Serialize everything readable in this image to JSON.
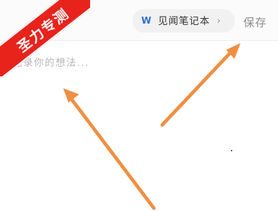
{
  "header": {
    "notebook": {
      "icon": "wps-w-icon",
      "icon_text": "W",
      "name": "见闻笔记本",
      "chevron": "›"
    },
    "save_label": "保存"
  },
  "editor": {
    "placeholder": "记录你的想法..."
  },
  "watermark": {
    "text": "圣力专测",
    "color": "#e8231c"
  },
  "annotation_color": "#ef8f43"
}
